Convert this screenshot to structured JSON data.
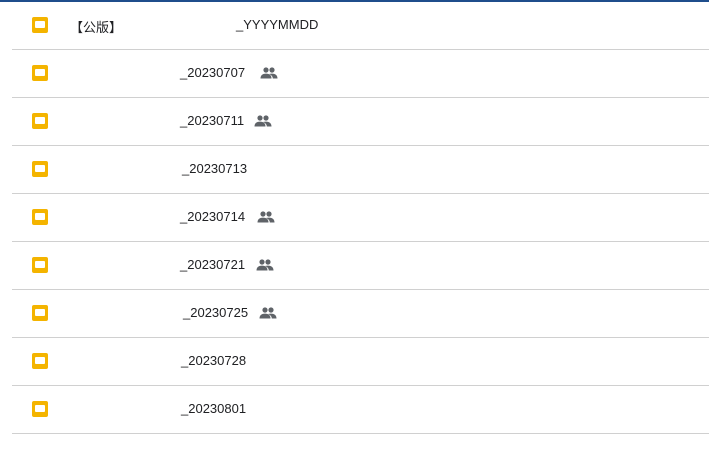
{
  "files": [
    {
      "prefix": "【公版】",
      "name": "_YYYYMMDD",
      "shared": false
    },
    {
      "prefix": "",
      "name": "_20230707",
      "shared": true
    },
    {
      "prefix": "",
      "name": "_20230711",
      "shared": true
    },
    {
      "prefix": "",
      "name": "_20230713",
      "shared": false
    },
    {
      "prefix": "",
      "name": "_20230714",
      "shared": true
    },
    {
      "prefix": "",
      "name": "_20230721",
      "shared": true
    },
    {
      "prefix": "",
      "name": "_20230725",
      "shared": true
    },
    {
      "prefix": "",
      "name": "_20230728",
      "shared": false
    },
    {
      "prefix": "",
      "name": "_20230801",
      "shared": false
    }
  ],
  "icons": {
    "file": "slides-file-icon",
    "shared": "shared-people-icon"
  },
  "colors": {
    "file_icon": "#f4b400",
    "top_rule": "#1f4e8c"
  }
}
